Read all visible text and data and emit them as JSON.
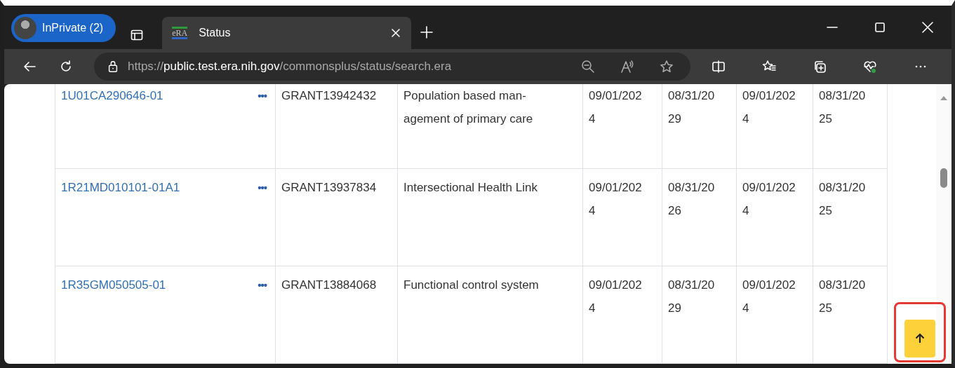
{
  "browser": {
    "profile": "InPrivate (2)",
    "tabs": [
      {
        "title": "Status",
        "favicon": "eRA",
        "selected": true
      }
    ],
    "url": {
      "scheme": "https://",
      "host": "public.test.era.nih.gov",
      "path": "/commonsplus/status/search.era"
    }
  },
  "table": {
    "rows": [
      {
        "grant": "1U01CA290646-01",
        "menu": "•••",
        "id": "GRANT13942432",
        "title": [
          "Population based man-",
          "agement of primary care"
        ],
        "dates": [
          [
            "09/01/202",
            "4"
          ],
          [
            "08/31/20",
            "29"
          ],
          [
            "09/01/202",
            "4"
          ],
          [
            "08/31/20",
            "25"
          ]
        ]
      },
      {
        "grant": "1R21MD010101-01A1",
        "menu": "•••",
        "id": "GRANT13937834",
        "title": [
          "Intersectional Health Link"
        ],
        "dates": [
          [
            "09/01/202",
            "4"
          ],
          [
            "08/31/20",
            "26"
          ],
          [
            "09/01/202",
            "4"
          ],
          [
            "08/31/20",
            "25"
          ]
        ]
      },
      {
        "grant": "1R35GM050505-01",
        "menu": "•••",
        "id": "GRANT13884068",
        "title": [
          "Functional control system"
        ],
        "dates": [
          [
            "09/01/202",
            "4"
          ],
          [
            "08/31/20",
            "29"
          ],
          [
            "09/01/202",
            "4"
          ],
          [
            "08/31/20",
            "25"
          ]
        ]
      }
    ]
  },
  "back_to_top": {
    "highlighted": true
  }
}
